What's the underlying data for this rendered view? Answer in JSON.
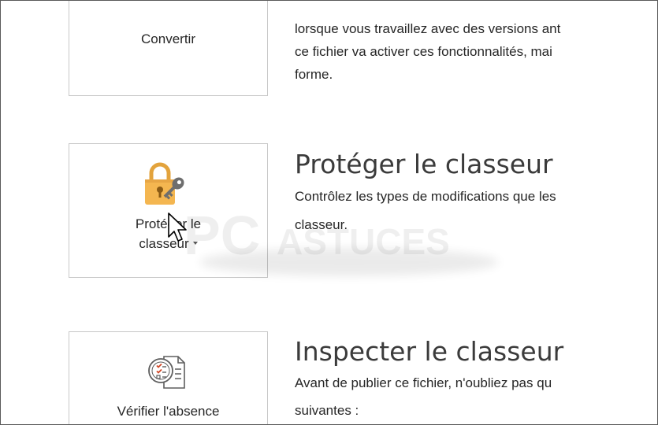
{
  "convert": {
    "button_label": "Convertir",
    "description_lines": [
      "lorsque vous travaillez avec des versions ant",
      "ce fichier va activer ces fonctionnalités, mai",
      "forme."
    ]
  },
  "protect": {
    "button_label_line1": "Protéger le",
    "button_label_line2": "classeur",
    "icon": "lock-key-icon",
    "title": "Protéger le classeur",
    "description_lines": [
      "Contrôlez les types de modifications que les",
      "classeur."
    ]
  },
  "inspect": {
    "button_label": "Vérifier l'absence",
    "icon": "document-checklist-icon",
    "title": "Inspecter le classeur",
    "description_lines": [
      "Avant de publier ce fichier, n'oubliez pas qu",
      "suivantes :"
    ]
  },
  "watermark": {
    "text_pc": "PC",
    "text_astuces": "ASTUCES"
  },
  "colors": {
    "lock_body": "#F4B650",
    "lock_shackle": "#E3A33C",
    "key": "#6E6E6E",
    "border": "#C8C8C8",
    "text": "#262626"
  }
}
